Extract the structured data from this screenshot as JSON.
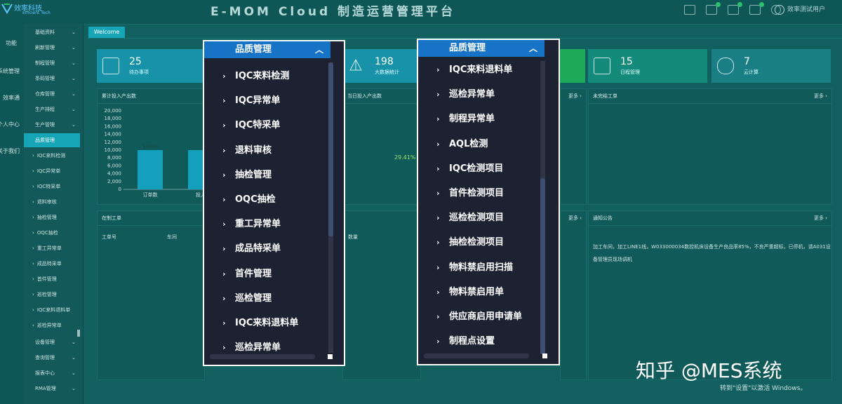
{
  "app": {
    "logo_name": "效率科技",
    "logo_sub": "Efficient Tech",
    "title": "E-MOM Cloud 制造运营管理平台",
    "user": "效率测试用户",
    "badges": [
      "0",
      "0",
      "0"
    ]
  },
  "leftnav": [
    "功能",
    "系统管理",
    "效率通",
    "个人中心",
    "关于我们"
  ],
  "menu": {
    "groups": [
      "基础资料",
      "刷新管理",
      "制程管理",
      "条码管理",
      "仓库管理",
      "生产排程",
      "生产管理",
      "品质管理"
    ],
    "active": "品质管理",
    "subitems": [
      "IQC来料检测",
      "IQC异常单",
      "IQC特采单",
      "退料审核",
      "抽检管理",
      "OQC抽检",
      "重工异常单",
      "成品特采单",
      "首件管理",
      "巡检管理",
      "IQC来料退料单",
      "巡检异常单"
    ],
    "bottom": [
      "设备管理",
      "查询管理",
      "报表中心",
      "RMA管理"
    ]
  },
  "tab": "Welcome",
  "cards": [
    {
      "num": "25",
      "label": "待办事项",
      "color": "#1792a8"
    },
    {
      "num": "198",
      "label": "大数据统计",
      "color": "#1792a8"
    },
    {
      "num": "",
      "label": "",
      "color": "#1faa5a"
    },
    {
      "num": "15",
      "label": "日程管理",
      "color": "#138a7a"
    },
    {
      "num": "7",
      "label": "云计算",
      "color": "#1a7f84"
    }
  ],
  "panels": {
    "p1_title": "累计投入产出数",
    "p2_title": "当日投入产出数",
    "p3_title": "未完结工单",
    "p4_title": "在制工单",
    "p5_title": "通知公告",
    "more": "更多 ›",
    "table_headers": [
      "工单号",
      "车间",
      "数量"
    ],
    "percent": "29.41%",
    "notice": "加工车间，加工LINE1线，W033000034数控机床设备生产良品率85%，不良严重超标，已停机，请A031设备管理员现场调机"
  },
  "chart_data": {
    "type": "bar",
    "categories": [
      "订单数",
      "投入"
    ],
    "values": [
      10000,
      10000
    ],
    "data_labels": [
      "10000",
      ""
    ],
    "yticks": [
      "20,000",
      "18,000",
      "16,000",
      "14,000",
      "12,000",
      "10,000",
      "8,000",
      "6,000",
      "4,000",
      "2,000",
      "0"
    ],
    "ylim": [
      0,
      20000
    ],
    "colors": [
      "#14a0bd"
    ]
  },
  "dropdown_left": {
    "header": "品质管理",
    "items": [
      "IQC来料检测",
      "IQC异常单",
      "IQC特采单",
      "退料审核",
      "抽检管理",
      "OQC抽检",
      "重工异常单",
      "成品特采单",
      "首件管理",
      "巡检管理",
      "IQC来料退料单",
      "巡检异常单"
    ],
    "scroll_fraction": 0.0
  },
  "dropdown_right": {
    "header": "品质管理",
    "items": [
      "IQC来料退料单",
      "巡检异常单",
      "制程异常单",
      "AQL检测",
      "IQC检测项目",
      "首件检测项目",
      "巡检检测项目",
      "抽检检测项目",
      "物料禁启用扫描",
      "物料禁启用单",
      "供应商启用申请单",
      "制程点设置"
    ],
    "scroll_fraction": 1.0
  },
  "watermark": "知乎 @MES系统",
  "activate": "转到\"设置\"以激活 Windows。"
}
